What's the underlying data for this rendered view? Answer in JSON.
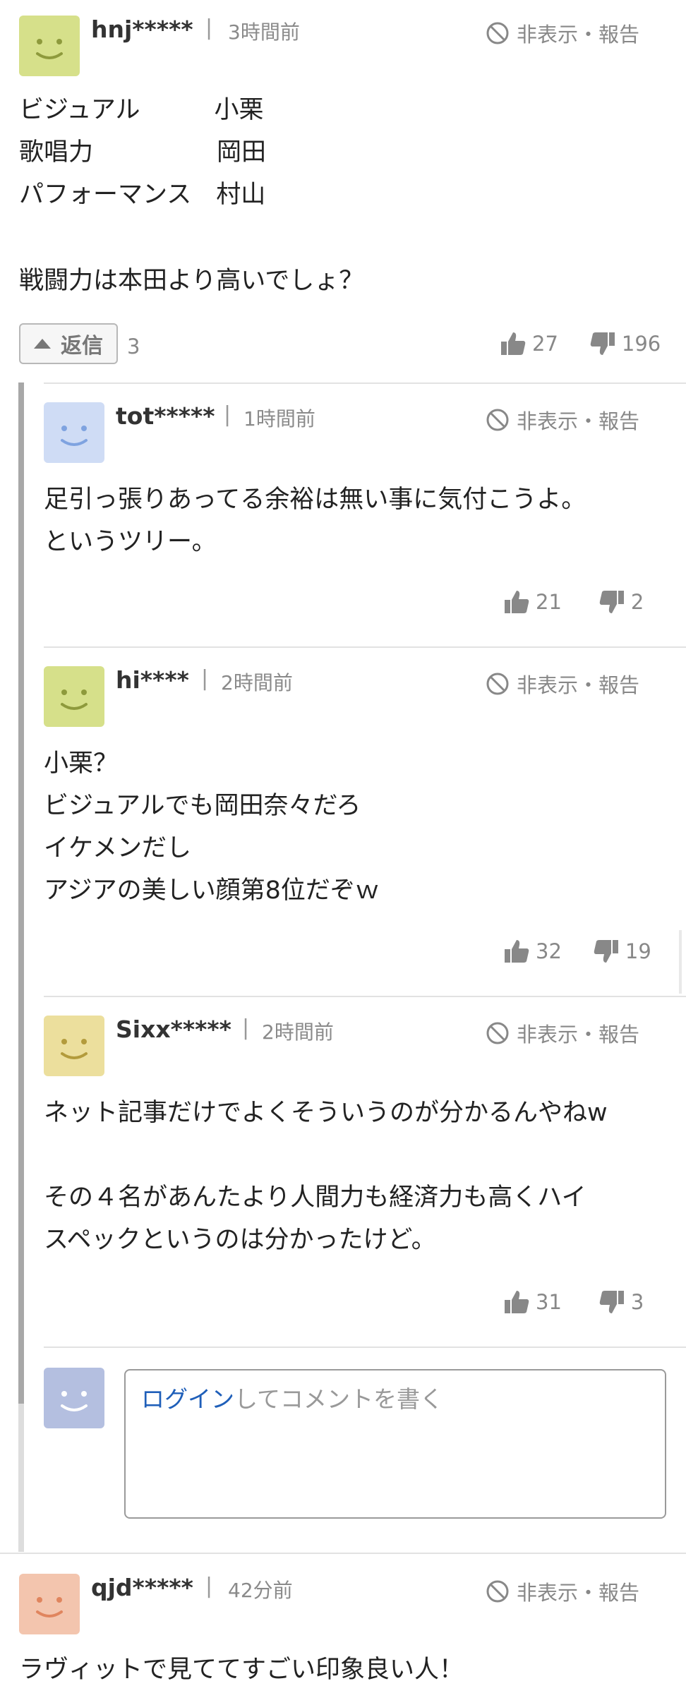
{
  "comments": [
    {
      "username": "hnj*****",
      "separator": "|",
      "time": "3時間前",
      "hide_report": "非表示・報告",
      "lines": [
        "ビジュアル　　　小栗",
        "歌唱力　　　　　岡田",
        "パフォーマンス　村山",
        "",
        "戦闘力は本田より高いでしょ？"
      ],
      "likes": "27",
      "dislikes": "196",
      "reply_label": "返信",
      "reply_count": "3",
      "avatar_color": "#d6e08a",
      "face_color": "#8e9a3c"
    }
  ],
  "replies": [
    {
      "username": "tot*****",
      "separator": "|",
      "time": "1時間前",
      "hide_report": "非表示・報告",
      "lines": [
        "足引っ張りあってる余裕は無い事に気付こうよ。",
        "というツリー。"
      ],
      "likes": "21",
      "dislikes": "2",
      "avatar_color": "#cfdcf5",
      "face_color": "#7fa3e0"
    },
    {
      "username": "hi****",
      "separator": "|",
      "time": "2時間前",
      "hide_report": "非表示・報告",
      "lines": [
        "小栗？",
        "ビジュアルでも岡田奈々だろ",
        "イケメンだし",
        "アジアの美しい顔第8位だぞｗ"
      ],
      "likes": "32",
      "dislikes": "19",
      "avatar_color": "#d6e08a",
      "face_color": "#8e9a3c"
    },
    {
      "username": "Sixx*****",
      "separator": "|",
      "time": "2時間前",
      "hide_report": "非表示・報告",
      "lines": [
        "ネット記事だけでよくそういうのが分かるんやねw",
        "",
        "その４名があんたより人間力も経済力も高くハイ",
        "スペックというのは分かったけど。"
      ],
      "likes": "31",
      "dislikes": "3",
      "avatar_color": "#ecdf9d",
      "face_color": "#b39b3c"
    }
  ],
  "comment_input": {
    "login_link": "ログイン",
    "placeholder_rest": "してコメントを書く",
    "avatar_color": "#b4bfe0",
    "face_color": "#ffffff"
  },
  "last_comment": {
    "username": "qjd*****",
    "separator": "|",
    "time": "42分前",
    "hide_report": "非表示・報告",
    "lines": [
      "ラヴィットで見ててすごい印象良い人！"
    ],
    "avatar_color": "#f3c5ae",
    "face_color": "#e0855e"
  },
  "icons": {
    "hide": "ban-icon",
    "like": "thumbs-up-icon",
    "dislike": "thumbs-down-icon",
    "reply": "triangle-up-icon",
    "avatar": "smiley-face-icon"
  },
  "colors": {
    "text": "#222222",
    "muted": "#888888",
    "link": "#1f5fb9",
    "divider": "#e2e2e2",
    "thread_bar": "#a8a8a8"
  }
}
